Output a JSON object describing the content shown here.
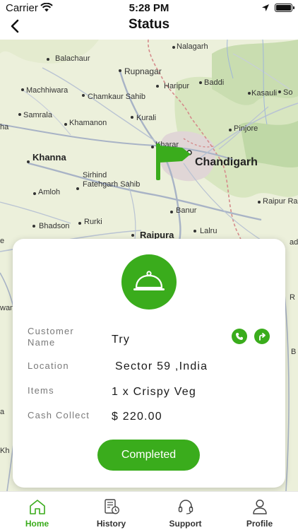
{
  "status_bar": {
    "carrier": "Carrier",
    "time": "5:28 PM"
  },
  "header": {
    "title": "Status"
  },
  "map": {
    "places": [
      {
        "name": "Balachaur"
      },
      {
        "name": "Nalagarh"
      },
      {
        "name": "Rupnagar"
      },
      {
        "name": "Baddi"
      },
      {
        "name": "Haripur"
      },
      {
        "name": "Machhiwara"
      },
      {
        "name": "Chamkaur Sahib"
      },
      {
        "name": "Kasauli"
      },
      {
        "name": "Samrala"
      },
      {
        "name": "Kurali"
      },
      {
        "name": "Khamanon"
      },
      {
        "name": "Pinjore"
      },
      {
        "name": "Kharar"
      },
      {
        "name": "Chandigarh"
      },
      {
        "name": "Khanna"
      },
      {
        "name": "Sirhind"
      },
      {
        "name": "Fatehgarh Sahib"
      },
      {
        "name": "Amloh"
      },
      {
        "name": "Raipur Ra"
      },
      {
        "name": "Banur"
      },
      {
        "name": "Bhadson"
      },
      {
        "name": "Rurki"
      },
      {
        "name": "Lalru"
      },
      {
        "name": "Raipura"
      },
      {
        "name": "So"
      }
    ]
  },
  "order": {
    "customer_label": "Customer\nName",
    "customer_value": "Try",
    "location_label": "Location",
    "location_value": "Sector 59 ,India",
    "items_label": "Items",
    "items_value": "1 x Crispy Veg",
    "cash_label": "Cash Collect",
    "cash_value": "$ 220.00",
    "action_label": "Completed"
  },
  "tabs": [
    {
      "label": "Home",
      "icon": "home-icon",
      "active": true
    },
    {
      "label": "History",
      "icon": "history-icon",
      "active": false
    },
    {
      "label": "Support",
      "icon": "headset-icon",
      "active": false
    },
    {
      "label": "Profile",
      "icon": "person-icon",
      "active": false
    }
  ],
  "colors": {
    "accent": "#3aac1c",
    "inactive_tab": "#333333"
  }
}
